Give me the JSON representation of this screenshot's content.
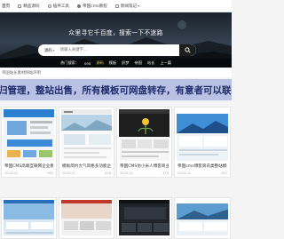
{
  "nav": {
    "items": [
      {
        "label": "首页",
        "icon": "home-icon",
        "caret": false
      },
      {
        "label": "精品源码",
        "icon": "code-icon",
        "caret": false
      },
      {
        "label": "插件工具",
        "icon": "plugin-icon",
        "caret": false
      },
      {
        "label": "帝国cms教程",
        "icon": "book-icon",
        "caret": false
      },
      {
        "label": "新闻笔记",
        "icon": "note-icon",
        "caret": true
      }
    ]
  },
  "hero": {
    "title": "众里寻它千百度，搜索一下不迷路",
    "search": {
      "type_label": "源码",
      "placeholder": "请输入关键字..."
    },
    "hot_tags": [
      {
        "label": "热门搜索：",
        "accent": false
      },
      {
        "label": "seo",
        "accent": false
      },
      {
        "label": "源码",
        "accent": true
      },
      {
        "label": "模板",
        "accent": false
      },
      {
        "label": "织梦",
        "accent": false
      },
      {
        "label": "帝国",
        "accent": false
      },
      {
        "label": "站长",
        "accent": false
      },
      {
        "label": "上一篇",
        "accent": false
      }
    ]
  },
  "notice": "帝国站长素材网站声明",
  "banner": {
    "text": "归管理，整站出售，所有模板可网盘转存，有意者可以联系客服"
  },
  "cards_row1": [
    {
      "title": "帝国CMS高端互联网企业模板",
      "date": "2024-01",
      "views": "562"
    },
    {
      "title": "模板简约大气风格多功能企业官网源码",
      "date": "2024-01",
      "views": "418"
    },
    {
      "title": "帝国CMS仿小米人博客商业美化完整版",
      "date": "2024-01",
      "views": "376"
    },
    {
      "title": "帝国cms博客资讯类整站模板",
      "date": "2024-01",
      "views": "291"
    }
  ],
  "cards_row2": [
    {
      "title": "",
      "date": "",
      "views": ""
    },
    {
      "title": "",
      "date": "",
      "views": ""
    },
    {
      "title": "",
      "date": "",
      "views": ""
    },
    {
      "title": "",
      "date": "",
      "views": ""
    }
  ],
  "colors": {
    "banner_bg": "#b9c2e4",
    "banner_text": "#1f2a6b",
    "hero_dark": "#1d2630",
    "accent": "#f4c430"
  }
}
